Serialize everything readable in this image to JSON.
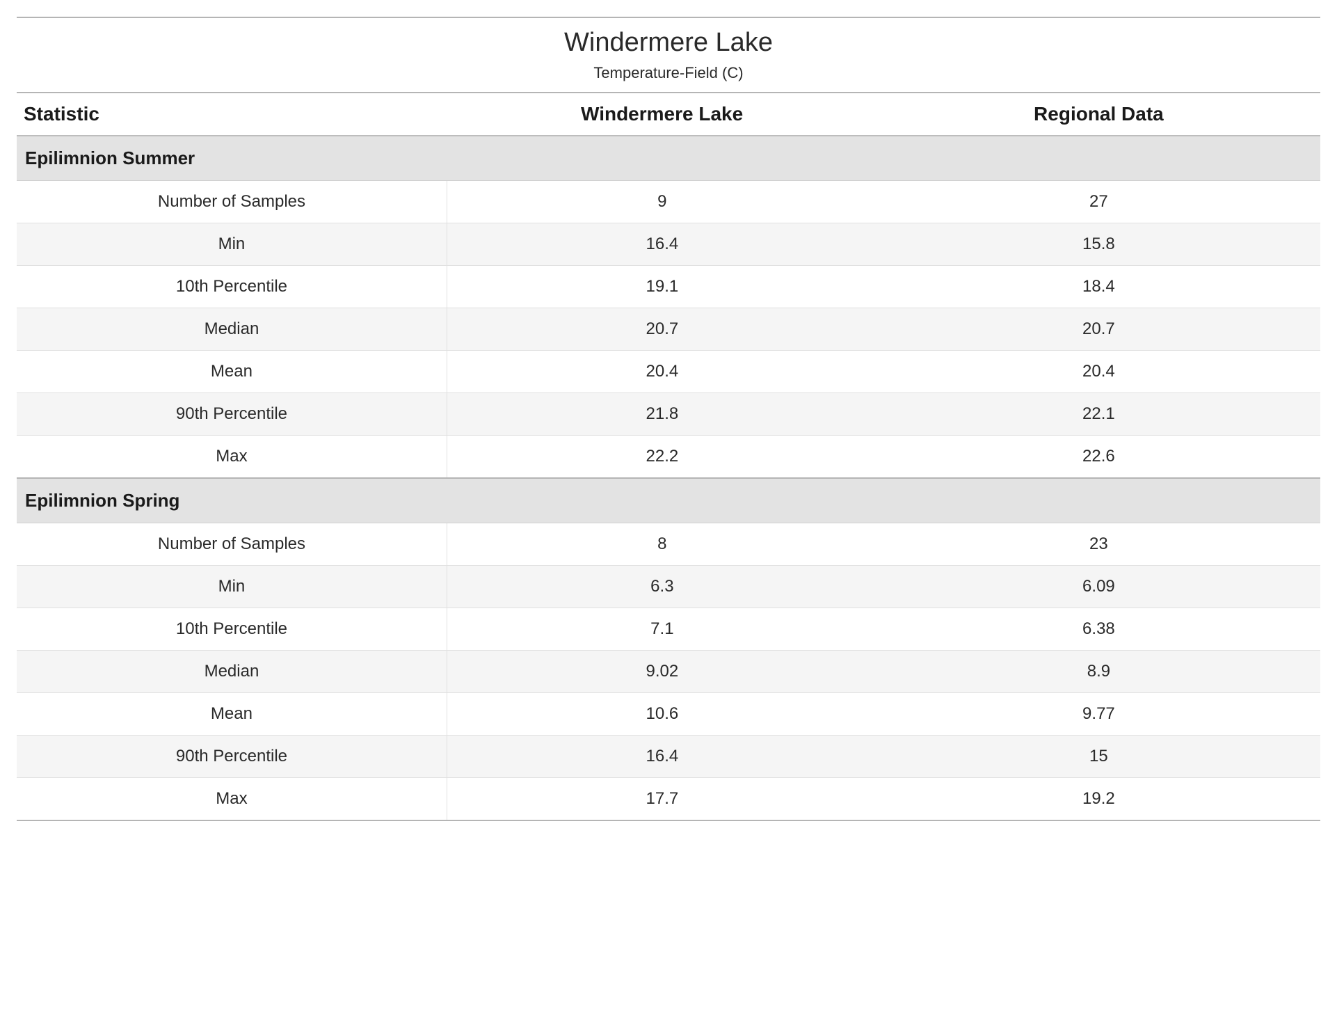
{
  "header": {
    "title": "Windermere Lake",
    "subtitle": "Temperature-Field (C)"
  },
  "columns": {
    "stat": "Statistic",
    "site": "Windermere Lake",
    "region": "Regional Data"
  },
  "sections": [
    {
      "title": "Epilimnion Summer",
      "rows": [
        {
          "stat": "Number of Samples",
          "site": "9",
          "region": "27"
        },
        {
          "stat": "Min",
          "site": "16.4",
          "region": "15.8"
        },
        {
          "stat": "10th Percentile",
          "site": "19.1",
          "region": "18.4"
        },
        {
          "stat": "Median",
          "site": "20.7",
          "region": "20.7"
        },
        {
          "stat": "Mean",
          "site": "20.4",
          "region": "20.4"
        },
        {
          "stat": "90th Percentile",
          "site": "21.8",
          "region": "22.1"
        },
        {
          "stat": "Max",
          "site": "22.2",
          "region": "22.6"
        }
      ]
    },
    {
      "title": "Epilimnion Spring",
      "rows": [
        {
          "stat": "Number of Samples",
          "site": "8",
          "region": "23"
        },
        {
          "stat": "Min",
          "site": "6.3",
          "region": "6.09"
        },
        {
          "stat": "10th Percentile",
          "site": "7.1",
          "region": "6.38"
        },
        {
          "stat": "Median",
          "site": "9.02",
          "region": "8.9"
        },
        {
          "stat": "Mean",
          "site": "10.6",
          "region": "9.77"
        },
        {
          "stat": "90th Percentile",
          "site": "16.4",
          "region": "15"
        },
        {
          "stat": "Max",
          "site": "17.7",
          "region": "19.2"
        }
      ]
    }
  ]
}
